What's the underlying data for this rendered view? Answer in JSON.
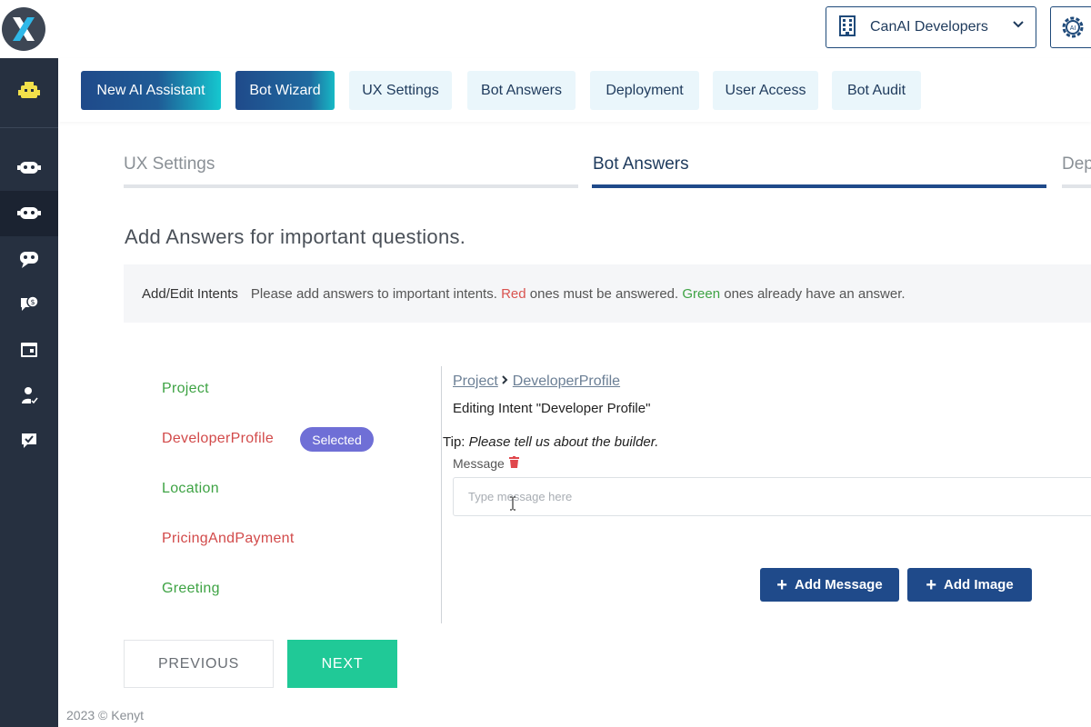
{
  "header": {
    "org_name": "CanAI Developers",
    "settings_badge": "AI"
  },
  "nav": {
    "items": [
      "New AI Assistant",
      "Bot Wizard",
      "UX Settings",
      "Bot Answers",
      "Deployment",
      "User Access",
      "Bot Audit"
    ]
  },
  "steps": {
    "items": [
      "UX Settings",
      "Bot Answers",
      "Dep"
    ],
    "active_index": 1
  },
  "page": {
    "heading": "Add Answers for important questions."
  },
  "info": {
    "label": "Add/Edit Intents",
    "text_before": "Please add answers to important intents.",
    "red_word": "Red",
    "text_middle": "ones must be answered.",
    "green_word": "Green",
    "text_after": "ones already have an answer."
  },
  "intents": [
    {
      "label": "Project",
      "status": "answered"
    },
    {
      "label": "DeveloperProfile",
      "status": "unanswered",
      "selected": true
    },
    {
      "label": "Location",
      "status": "answered"
    },
    {
      "label": "PricingAndPayment",
      "status": "unanswered"
    },
    {
      "label": "Greeting",
      "status": "answered"
    }
  ],
  "selected_badge": "Selected",
  "editor": {
    "breadcrumb": [
      "Project",
      "DeveloperProfile"
    ],
    "title": "Editing Intent \"Developer Profile\"",
    "tip_label": "Tip:",
    "tip_text": "Please tell us about the builder.",
    "message_label": "Message",
    "message_value": "",
    "message_placeholder": "Type message here",
    "add_message": "Add Message",
    "add_image": "Add Image"
  },
  "footer_nav": {
    "previous": "PREVIOUS",
    "next": "NEXT"
  },
  "footer": "2023 © Kenyt",
  "colors": {
    "sidebar": "#263040",
    "primary": "#1f4a8a",
    "accent_cyan": "#15c7cf",
    "next_green": "#20c997",
    "answered": "#3ea344",
    "unanswered": "#d24a4a",
    "badge": "#6f6fd6",
    "icon_yellow": "#f2e04a"
  }
}
